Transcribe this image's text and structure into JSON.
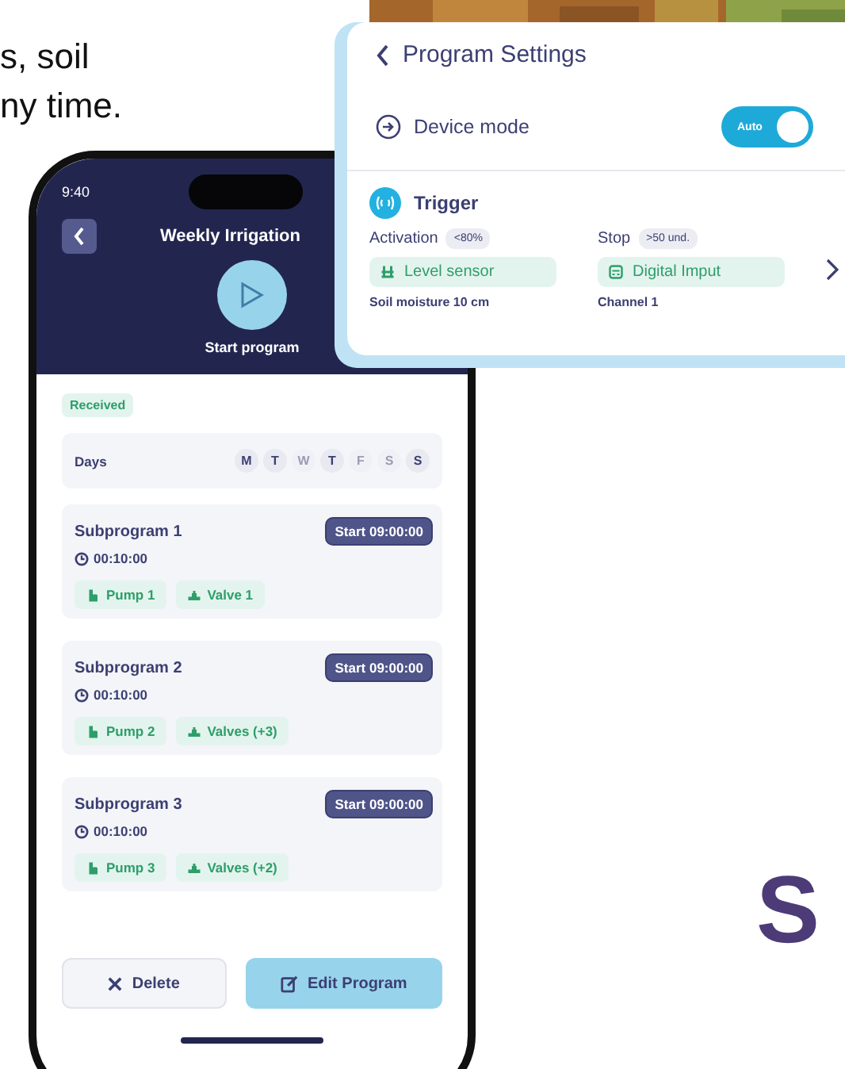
{
  "intro_text": [
    "s, soil",
    "ny time."
  ],
  "header_photo": {
    "kind": "picture"
  },
  "phone": {
    "status_time": "9:40",
    "title": "Weekly Irrigation",
    "start_label": "Start program",
    "status_badge": "Received",
    "days_label": "Days",
    "days": [
      {
        "label": "M",
        "selected": true
      },
      {
        "label": "T",
        "selected": true
      },
      {
        "label": "W",
        "selected": false
      },
      {
        "label": "T",
        "selected": true
      },
      {
        "label": "F",
        "selected": false
      },
      {
        "label": "S",
        "selected": false
      },
      {
        "label": "S",
        "selected": true
      }
    ],
    "subprograms": [
      {
        "name": "Subprogram 1",
        "duration": "00:10:00",
        "start": "Start 09:00:00",
        "chips": [
          {
            "kind": "pump",
            "label": "Pump 1"
          },
          {
            "kind": "valve",
            "label": "Valve 1"
          }
        ]
      },
      {
        "name": "Subprogram 2",
        "duration": "00:10:00",
        "start": "Start 09:00:00",
        "chips": [
          {
            "kind": "pump",
            "label": "Pump 2"
          },
          {
            "kind": "valve",
            "label": "Valves (+3)"
          }
        ]
      },
      {
        "name": "Subprogram 3",
        "duration": "00:10:00",
        "start": "Start 09:00:00",
        "chips": [
          {
            "kind": "pump",
            "label": "Pump 3"
          },
          {
            "kind": "valve",
            "label": "Valves (+2)"
          }
        ]
      }
    ],
    "buttons": [
      {
        "kind": "delete",
        "label": "Delete"
      },
      {
        "kind": "edit",
        "label": "Edit Program"
      }
    ]
  },
  "settings_card": {
    "title": "Program Settings",
    "device_mode": {
      "label": "Device mode",
      "toggle_label": "Auto",
      "on": true
    },
    "trigger": {
      "title": "Trigger",
      "columns": [
        {
          "label": "Activation",
          "badge": "<80%",
          "kind": "level",
          "sensor": "Level sensor",
          "detail": "Soil moisture 10 cm"
        },
        {
          "label": "Stop",
          "badge": ">50 und.",
          "kind": "digital",
          "sensor": "Digital Imput",
          "detail": "Channel 1"
        }
      ]
    }
  },
  "logo": {
    "text": "S"
  }
}
